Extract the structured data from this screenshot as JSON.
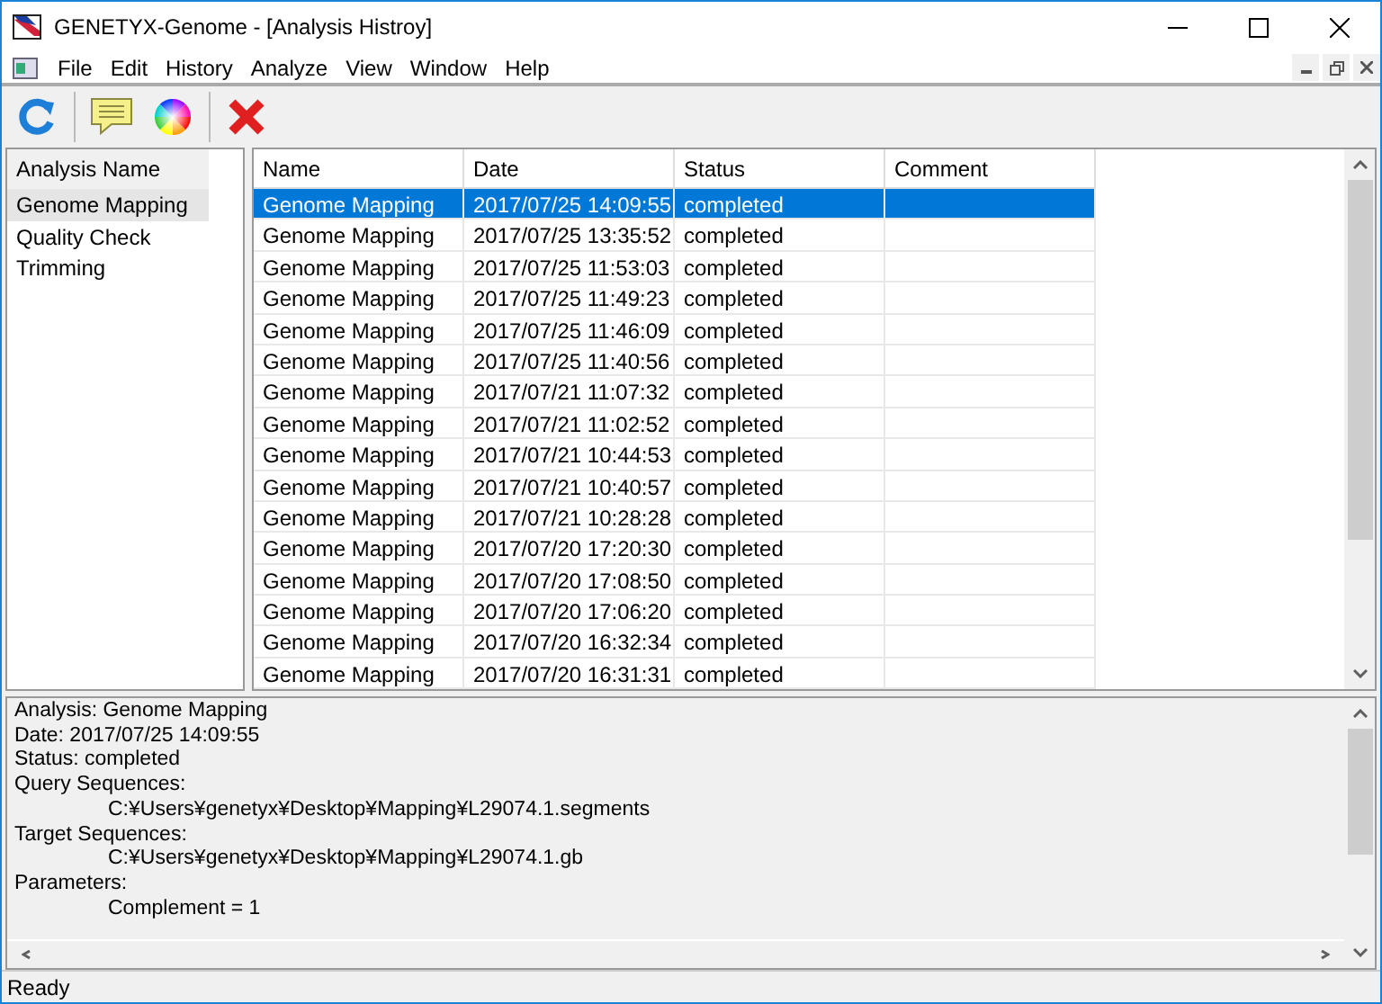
{
  "window": {
    "title": "GENETYX-Genome - [Analysis Histroy]"
  },
  "menu": [
    "File",
    "Edit",
    "History",
    "Analyze",
    "View",
    "Window",
    "Help"
  ],
  "analysis_list": {
    "header": "Analysis Name",
    "items": [
      {
        "label": "Genome Mapping",
        "selected": true
      },
      {
        "label": "Quality Check",
        "selected": false
      },
      {
        "label": "Trimming",
        "selected": false
      }
    ]
  },
  "table": {
    "columns": [
      "Name",
      "Date",
      "Status",
      "Comment"
    ],
    "rows": [
      {
        "cells": [
          "Genome Mapping",
          "2017/07/25 14:09:55",
          "completed"
        ],
        "selected": true
      },
      {
        "cells": [
          "Genome Mapping",
          "2017/07/25 13:35:52",
          "completed"
        ],
        "selected": false
      },
      {
        "cells": [
          "Genome Mapping",
          "2017/07/25 11:53:03",
          "completed"
        ],
        "selected": false
      },
      {
        "cells": [
          "Genome Mapping",
          "2017/07/25 11:49:23",
          "completed"
        ],
        "selected": false
      },
      {
        "cells": [
          "Genome Mapping",
          "2017/07/25 11:46:09",
          "completed"
        ],
        "selected": false
      },
      {
        "cells": [
          "Genome Mapping",
          "2017/07/25 11:40:56",
          "completed"
        ],
        "selected": false
      },
      {
        "cells": [
          "Genome Mapping",
          "2017/07/21 11:07:32",
          "completed"
        ],
        "selected": false
      },
      {
        "cells": [
          "Genome Mapping",
          "2017/07/21 11:02:52",
          "completed"
        ],
        "selected": false
      },
      {
        "cells": [
          "Genome Mapping",
          "2017/07/21 10:44:53",
          "completed"
        ],
        "selected": false
      },
      {
        "cells": [
          "Genome Mapping",
          "2017/07/21 10:40:57",
          "completed"
        ],
        "selected": false
      },
      {
        "cells": [
          "Genome Mapping",
          "2017/07/21 10:28:28",
          "completed"
        ],
        "selected": false
      },
      {
        "cells": [
          "Genome Mapping",
          "2017/07/20 17:20:30",
          "completed"
        ],
        "selected": false
      },
      {
        "cells": [
          "Genome Mapping",
          "2017/07/20 17:08:50",
          "completed"
        ],
        "selected": false
      },
      {
        "cells": [
          "Genome Mapping",
          "2017/07/20 17:06:20",
          "completed"
        ],
        "selected": false
      },
      {
        "cells": [
          "Genome Mapping",
          "2017/07/20 16:32:34",
          "completed"
        ],
        "selected": false
      },
      {
        "cells": [
          "Genome Mapping",
          "2017/07/20 16:31:31",
          "completed"
        ],
        "selected": false
      }
    ]
  },
  "details": [
    {
      "text": "Analysis: Genome Mapping",
      "indented": false
    },
    {
      "text": "Date: 2017/07/25 14:09:55",
      "indented": false
    },
    {
      "text": "Status: completed",
      "indented": false
    },
    {
      "text": "Query Sequences:",
      "indented": false
    },
    {
      "text": "C:¥Users¥genetyx¥Desktop¥Mapping¥L29074.1.segments",
      "indented": true
    },
    {
      "text": "Target Sequences:",
      "indented": false
    },
    {
      "text": "C:¥Users¥genetyx¥Desktop¥Mapping¥L29074.1.gb",
      "indented": true
    },
    {
      "text": "Parameters:",
      "indented": false
    },
    {
      "text": "Complement = 1",
      "indented": true
    }
  ],
  "status_bar": "Ready"
}
